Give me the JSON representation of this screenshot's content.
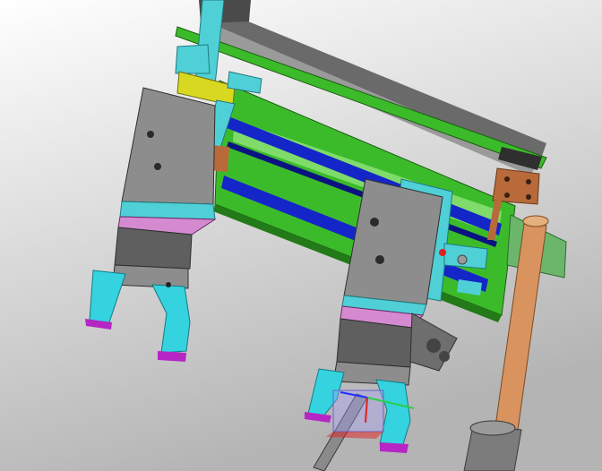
{
  "viewport": {
    "background_top": "#ffffff",
    "background_bottom": "#b4b4b4"
  },
  "model": {
    "part_colors": {
      "frame_green": "#3cbb2a",
      "frame_green_dark": "#237a18",
      "rail_blue": "#1526c8",
      "bracket_cyan": "#4fd0d6",
      "cylinder_gray": "#8d8d8d",
      "cylinder_gray_dark": "#5f5f5f",
      "jaw_cyan": "#34d3df",
      "jaw_tip_magenta": "#b526c4",
      "band_pink": "#d58ad0",
      "bracket_yellow": "#d8d820",
      "plate_copper": "#b86a3a",
      "post_copper": "#d9935e",
      "mount_green": "#6bb66b",
      "beam_gray": "#6a6a6a"
    },
    "triad_icon": "coordinate-triad-icon"
  }
}
